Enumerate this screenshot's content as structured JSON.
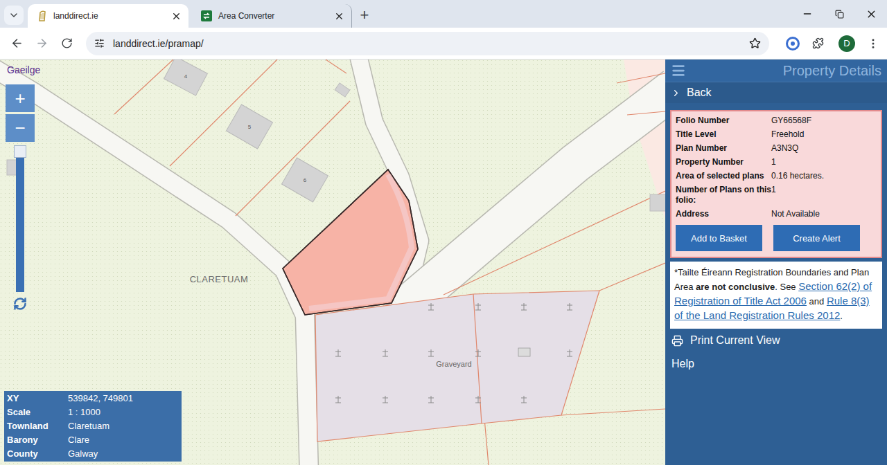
{
  "browser": {
    "tabs": [
      {
        "label": "landdirect.ie",
        "selected": true
      },
      {
        "label": "Area Converter",
        "selected": false
      }
    ],
    "new_tab": "+",
    "url": "landdirect.ie/pramap/",
    "profile_initial": "D"
  },
  "map": {
    "language_link": "Gaeilge",
    "zoom": {
      "in": "+",
      "out": "−",
      "level": 1
    },
    "labels": {
      "townland": "CLARETUAM",
      "graveyard": "Graveyard"
    },
    "house_numbers": [
      "4",
      "5",
      "6"
    ],
    "info": [
      {
        "label": "XY",
        "value": "539842, 749801"
      },
      {
        "label": "Scale",
        "value": "1 : 1000"
      },
      {
        "label": "Townland",
        "value": "Claretuam"
      },
      {
        "label": "Barony",
        "value": "Clare"
      },
      {
        "label": "County",
        "value": "Galway"
      }
    ]
  },
  "panel": {
    "title": "Property Details",
    "back": "Back",
    "details": [
      {
        "label": "Folio Number",
        "value": "GY66568F"
      },
      {
        "label": "Title Level",
        "value": "Freehold"
      },
      {
        "label": "Plan Number",
        "value": "A3N3Q"
      },
      {
        "label": "Property Number",
        "value": "1"
      },
      {
        "label": "Area of selected plans",
        "value": "0.16 hectares."
      },
      {
        "label": "Number of Plans on this folio:",
        "value": "1"
      },
      {
        "label": "Address",
        "value": "Not Available"
      }
    ],
    "buttons": [
      "Add to Basket",
      "Create Alert"
    ],
    "notice": [
      {
        "text": "*Tailte Éireann Registration Boundaries and Plan Area ",
        "kind": "plain"
      },
      {
        "text": "are not conclusive",
        "kind": "bold"
      },
      {
        "text": ". See ",
        "kind": "plain"
      },
      {
        "text": "Section 62(2) of Registration of Title Act 2006",
        "kind": "link"
      },
      {
        "text": " and ",
        "kind": "plain"
      },
      {
        "text": "Rule 8(3) of the Land Registration Rules 2012",
        "kind": "link"
      },
      {
        "text": ".",
        "kind": "plain"
      }
    ],
    "menu": [
      {
        "label": "Print Current View",
        "kind": "icon"
      },
      {
        "label": "Help",
        "kind": "plain"
      }
    ]
  }
}
